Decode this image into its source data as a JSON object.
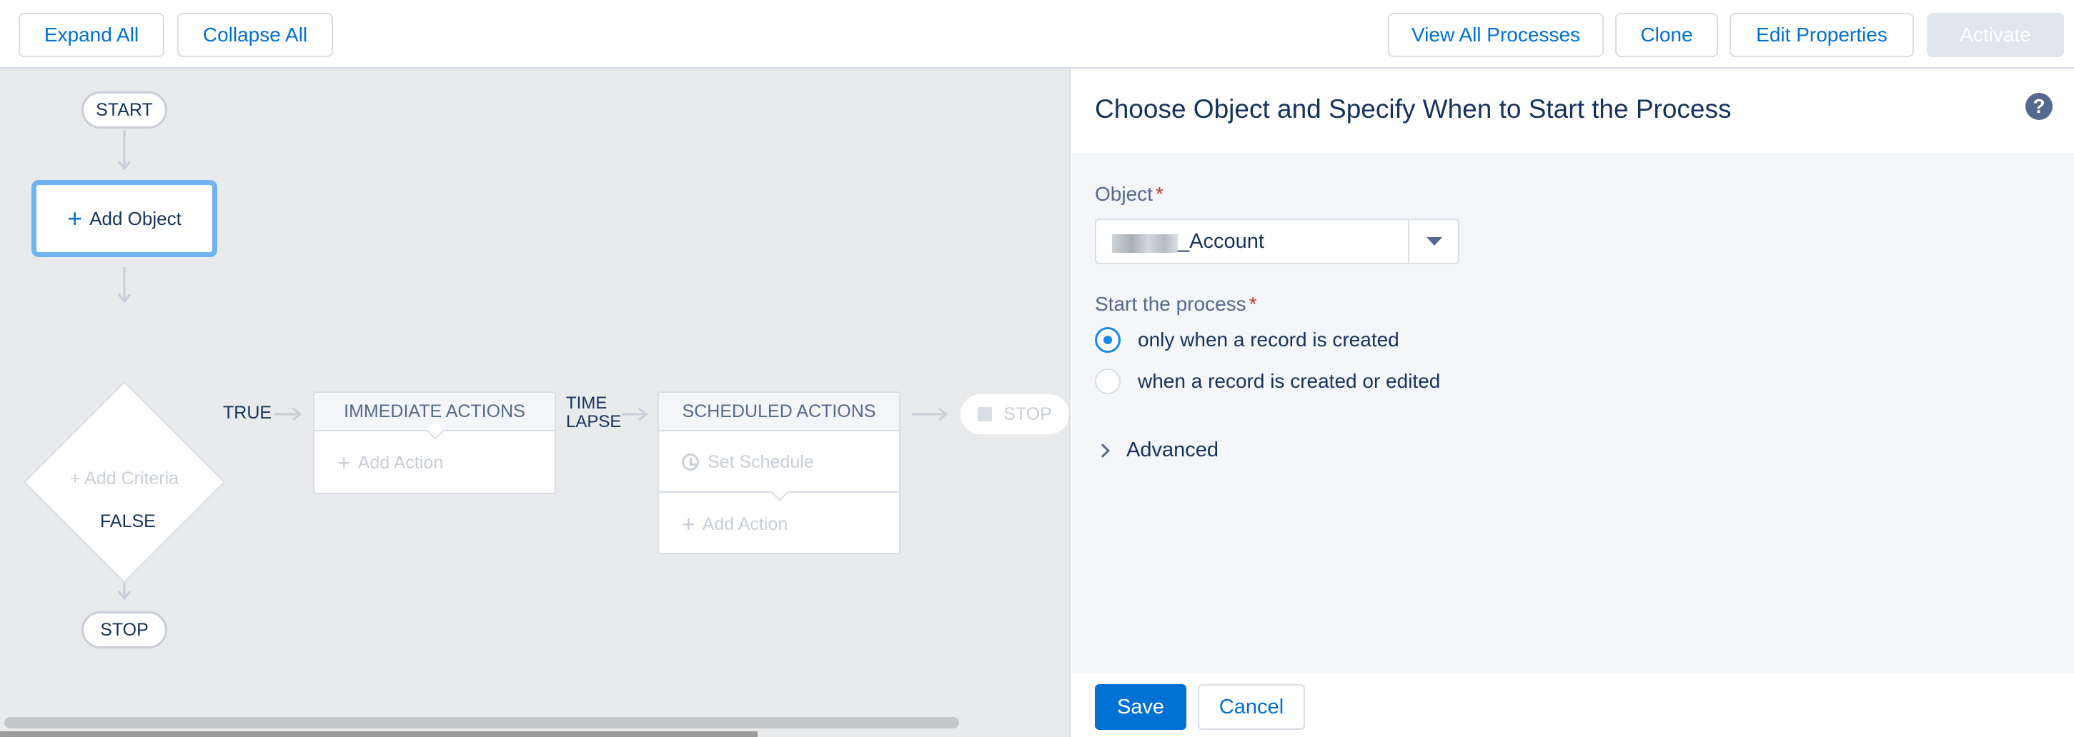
{
  "toolbar": {
    "expand_all": "Expand All",
    "collapse_all": "Collapse All",
    "view_all_processes": "View All Processes",
    "clone": "Clone",
    "edit_properties": "Edit Properties",
    "activate": "Activate"
  },
  "canvas": {
    "start": "START",
    "add_object": "Add Object",
    "add_criteria": "Add Criteria",
    "true_label": "TRUE",
    "false_label": "FALSE",
    "stop_bottom": "STOP",
    "time_lapse_line1": "TIME",
    "time_lapse_line2": "LAPSE",
    "immediate_actions": {
      "title": "IMMEDIATE ACTIONS",
      "add_action": "Add Action"
    },
    "scheduled_actions": {
      "title": "SCHEDULED ACTIONS",
      "set_schedule": "Set Schedule",
      "add_action": "Add Action"
    },
    "stop_right": "STOP"
  },
  "panel": {
    "title": "Choose Object and Specify When to Start the Process",
    "object_label": "Object",
    "object_value": "_Account",
    "start_label": "Start the process",
    "required_marker": "*",
    "options": [
      {
        "label": "only when a record is created",
        "checked": true
      },
      {
        "label": "when a record is created or edited",
        "checked": false
      }
    ],
    "advanced": "Advanced",
    "save": "Save",
    "cancel": "Cancel"
  },
  "colors": {
    "brand": "#0070d2",
    "canvas_bg": "#e9eaec",
    "panel_bg": "#f4f6f9",
    "selected_border": "#6fb3f2",
    "radio_checked": "#1589ee",
    "required": "#c23934"
  }
}
